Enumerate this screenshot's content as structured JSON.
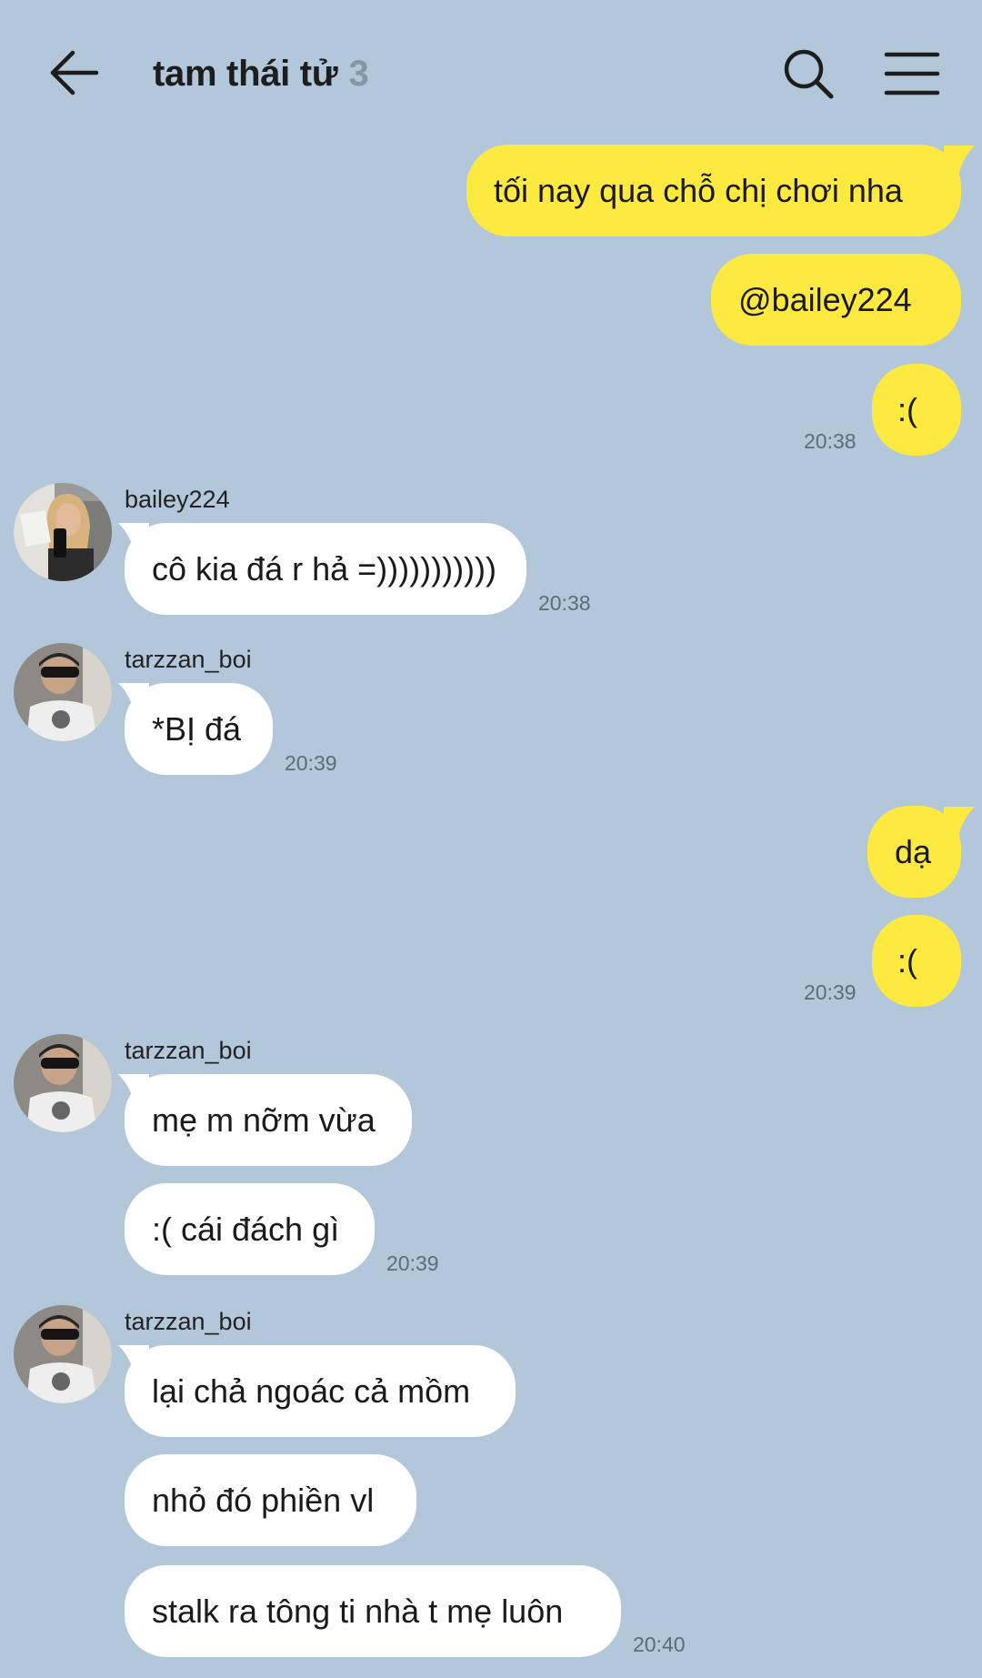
{
  "header": {
    "title": "tam thái tử",
    "member_count": "3",
    "back_icon": "arrow-left-icon",
    "search_icon": "search-icon",
    "menu_icon": "hamburger-menu-icon"
  },
  "colors": {
    "background": "#b2c7da",
    "outgoing_bubble": "#fee941",
    "incoming_bubble": "#ffffff"
  },
  "messages": [
    {
      "text": "tối nay qua chỗ chị chơi nha",
      "dir": "out"
    },
    {
      "text": "@bailey224",
      "dir": "out"
    },
    {
      "text": ":(",
      "dir": "out",
      "time": "20:38"
    },
    {
      "sender": "bailey224",
      "text": "cô kia đá r hả =)))))))))))",
      "dir": "in",
      "time": "20:38"
    },
    {
      "sender": "tarzzan_boi",
      "text": "*BỊ đá",
      "dir": "in",
      "time": "20:39"
    },
    {
      "text": "dạ",
      "dir": "out"
    },
    {
      "text": ":(",
      "dir": "out",
      "time": "20:39"
    },
    {
      "sender": "tarzzan_boi",
      "text": "mẹ m nỡm vừa",
      "dir": "in"
    },
    {
      "text": ":( cái đách gì",
      "dir": "in",
      "time": "20:39"
    },
    {
      "sender": "tarzzan_boi",
      "text": "lại chả ngoác cả mồm",
      "dir": "in"
    },
    {
      "text": "nhỏ đó phiền vl",
      "dir": "in"
    },
    {
      "text": "stalk ra tông ti nhà t mẹ luôn",
      "dir": "in",
      "time": "20:40"
    }
  ]
}
